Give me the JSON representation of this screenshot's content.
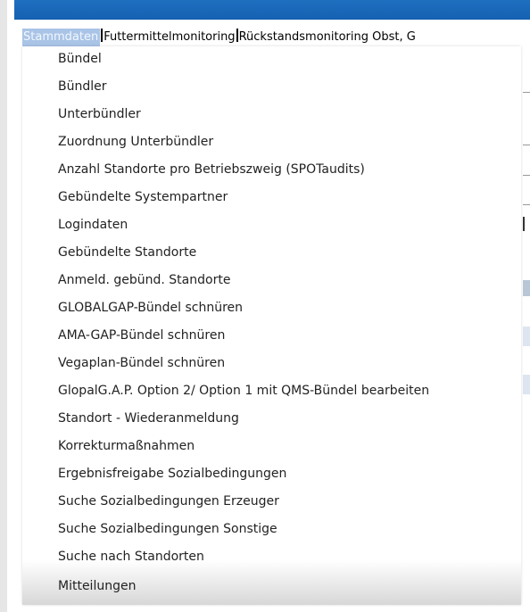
{
  "menubar": {
    "items": [
      {
        "label": "Stammdaten"
      },
      {
        "label": "Futtermittelmonitoring"
      },
      {
        "label": "Rückstandsmonitoring Obst, G"
      }
    ]
  },
  "dropdown": {
    "items": [
      {
        "label": "Bündel"
      },
      {
        "label": "Bündler"
      },
      {
        "label": "Unterbündler"
      },
      {
        "label": "Zuordnung Unterbündler"
      },
      {
        "label": "Anzahl Standorte pro Betriebszweig (SPOTaudits)"
      },
      {
        "label": "Gebündelte Systempartner"
      },
      {
        "label": "Logindaten"
      },
      {
        "label": "Gebündelte Standorte"
      },
      {
        "label": "Anmeld. gebünd. Standorte"
      },
      {
        "label": "GLOBALGAP-Bündel schnüren"
      },
      {
        "label": "AMA-GAP-Bündel schnüren"
      },
      {
        "label": "Vegaplan-Bündel schnüren"
      },
      {
        "label": "GlopalG.A.P. Option 2/ Option 1 mit QMS-Bündel bearbeiten"
      },
      {
        "label": "Standort - Wiederanmeldung"
      },
      {
        "label": "Korrekturmaßnahmen"
      },
      {
        "label": "Ergebnisfreigabe Sozialbedingungen"
      },
      {
        "label": "Suche Sozialbedingungen Erzeuger"
      },
      {
        "label": "Suche Sozialbedingungen Sonstige"
      },
      {
        "label": "Suche nach Standorten"
      },
      {
        "label": "Mitteilungen"
      }
    ]
  },
  "colors": {
    "top_bar": "#1565b5",
    "active_menu_bg": "#a9c4e6"
  }
}
